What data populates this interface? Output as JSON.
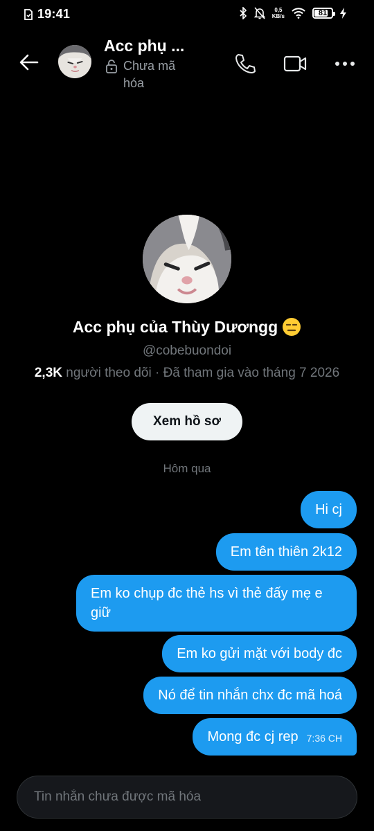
{
  "status_bar": {
    "time": "19:41",
    "net_speed_value": "0,5",
    "net_speed_unit": "KB/s",
    "battery": "81",
    "battery_level": 0.81
  },
  "header": {
    "name": "Acc phụ ...",
    "encryption_status": "Chưa mã hóa"
  },
  "profile": {
    "name": "Acc phụ của Thùy Dươngg",
    "handle": "@cobebuondoi",
    "followers_count": "2,3K",
    "followers_label": "người theo dõi · Đã tham gia vào tháng 7 2026",
    "view_profile_button": "Xem hồ sơ"
  },
  "date_separator": "Hôm qua",
  "messages": [
    {
      "text": "Hi cj"
    },
    {
      "text": "Em tên thiên 2k12"
    },
    {
      "text": "Em ko chụp đc thẻ hs vì thẻ đấy mẹ e giữ"
    },
    {
      "text": "Em ko gửi mặt với body đc"
    },
    {
      "text": "Nó để tin nhắn chx đc mã hoá"
    },
    {
      "text": "Mong đc cj rep",
      "time": "7:36 CH"
    }
  ],
  "composer": {
    "placeholder": "Tin nhắn chưa được mã hóa"
  },
  "colors": {
    "accent": "#1d9bf0",
    "background": "#000000",
    "secondary_text": "#71767b"
  }
}
